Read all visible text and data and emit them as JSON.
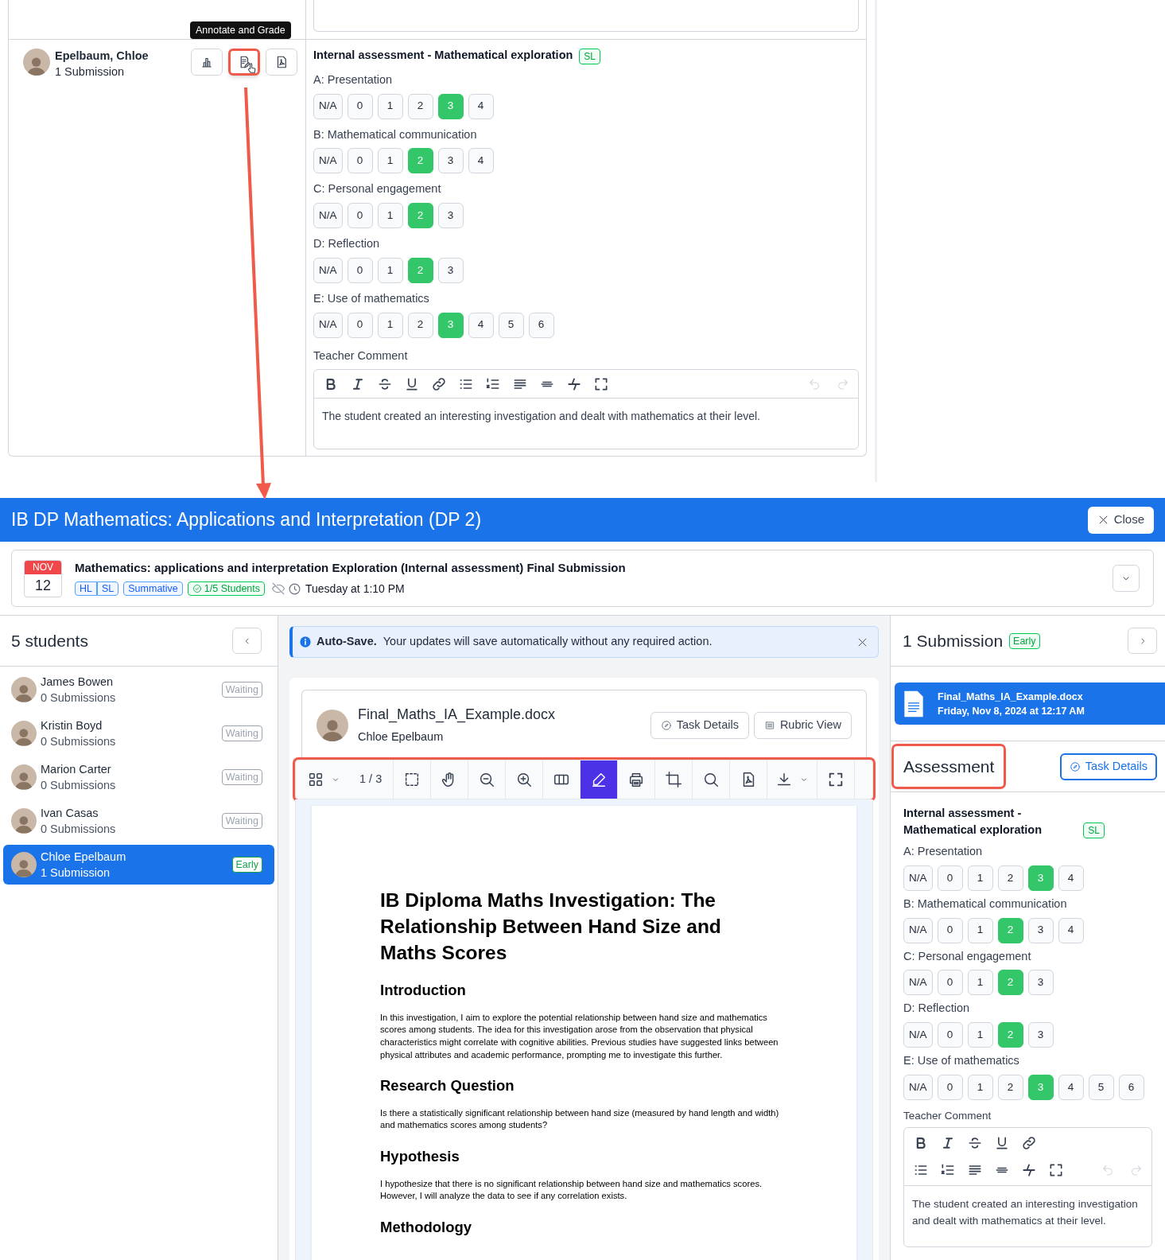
{
  "top_panel": {
    "tooltip": "Annotate and Grade",
    "student": {
      "name": "Epelbaum, Chloe",
      "submissions": "1 Submission"
    },
    "actions": [
      {
        "kind": "chart",
        "highlighted": false
      },
      {
        "kind": "annotate",
        "highlighted": true
      },
      {
        "kind": "pdf",
        "highlighted": false
      }
    ],
    "rubric": {
      "title": "Internal assessment - Mathematical exploration",
      "badge": "SL",
      "criteria": [
        {
          "label": "A: Presentation",
          "options": [
            {
              "label": "N/A",
              "selected": false
            },
            {
              "label": "0",
              "selected": false
            },
            {
              "label": "1",
              "selected": false
            },
            {
              "label": "2",
              "selected": false
            },
            {
              "label": "3",
              "selected": true
            },
            {
              "label": "4",
              "selected": false
            }
          ]
        },
        {
          "label": "B: Mathematical communication",
          "options": [
            {
              "label": "N/A",
              "selected": false
            },
            {
              "label": "0",
              "selected": false
            },
            {
              "label": "1",
              "selected": false
            },
            {
              "label": "2",
              "selected": true
            },
            {
              "label": "3",
              "selected": false
            },
            {
              "label": "4",
              "selected": false
            }
          ]
        },
        {
          "label": "C: Personal engagement",
          "options": [
            {
              "label": "N/A",
              "selected": false
            },
            {
              "label": "0",
              "selected": false
            },
            {
              "label": "1",
              "selected": false
            },
            {
              "label": "2",
              "selected": true
            },
            {
              "label": "3",
              "selected": false
            }
          ]
        },
        {
          "label": "D: Reflection",
          "options": [
            {
              "label": "N/A",
              "selected": false
            },
            {
              "label": "0",
              "selected": false
            },
            {
              "label": "1",
              "selected": false
            },
            {
              "label": "2",
              "selected": true
            },
            {
              "label": "3",
              "selected": false
            }
          ]
        },
        {
          "label": "E: Use of mathematics",
          "options": [
            {
              "label": "N/A",
              "selected": false
            },
            {
              "label": "0",
              "selected": false
            },
            {
              "label": "1",
              "selected": false
            },
            {
              "label": "2",
              "selected": false
            },
            {
              "label": "3",
              "selected": true
            },
            {
              "label": "4",
              "selected": false
            },
            {
              "label": "5",
              "selected": false
            },
            {
              "label": "6",
              "selected": false
            }
          ]
        }
      ]
    },
    "comment_label": "Teacher Comment",
    "comment": "The student created an interesting investigation and dealt with mathematics at their level."
  },
  "header": {
    "title": "IB DP Mathematics: Applications and Interpretation (DP 2)",
    "close": "Close"
  },
  "task": {
    "month": "NOV",
    "day": "12",
    "title": "Mathematics: applications and interpretation Exploration (Internal assessment) Final Submission",
    "tags": [
      {
        "label": "HL",
        "kind": "level"
      },
      {
        "label": "SL",
        "kind": "level"
      },
      {
        "label": "Summative",
        "kind": "type"
      },
      {
        "label": "1/5 Students",
        "kind": "count"
      }
    ],
    "due": "Tuesday at 1:10 PM"
  },
  "students": {
    "title": "5 students",
    "items": [
      {
        "name": "James Bowen",
        "submissions": "0 Submissions",
        "status": "Waiting",
        "color": "#9ca3af",
        "selected": false
      },
      {
        "name": "Kristin Boyd",
        "submissions": "0 Submissions",
        "status": "Waiting",
        "color": "#9ca3af",
        "selected": false
      },
      {
        "name": "Marion Carter",
        "submissions": "0 Submissions",
        "status": "Waiting",
        "color": "#9ca3af",
        "selected": false
      },
      {
        "name": "Ivan Casas",
        "submissions": "0 Submissions",
        "status": "Waiting",
        "color": "#9ca3af",
        "selected": false
      },
      {
        "name": "Chloe Epelbaum",
        "submissions": "1 Submission",
        "status": "Early",
        "color": "#16a34a",
        "selected": true
      }
    ]
  },
  "alert": {
    "title": "Auto-Save.",
    "message": "Your updates will save automatically without any required action."
  },
  "document": {
    "file": "Final_Maths_IA_Example.docx",
    "student": "Chloe Epelbaum",
    "buttons": [
      "Task Details",
      "Rubric View"
    ],
    "toolbar": {
      "highlighted": true,
      "tools": [
        {
          "kind": "grid",
          "selected": false
        },
        {
          "kind": "page",
          "label": "1 / 3",
          "selected": false
        },
        {
          "kind": "select",
          "selected": false
        },
        {
          "kind": "hand",
          "selected": false
        },
        {
          "kind": "zoom-out",
          "selected": false
        },
        {
          "kind": "zoom-in",
          "selected": false
        },
        {
          "kind": "columns",
          "selected": false
        },
        {
          "kind": "pen",
          "selected": true
        },
        {
          "kind": "print",
          "selected": false
        },
        {
          "kind": "crop",
          "selected": false
        },
        {
          "kind": "search",
          "selected": false
        },
        {
          "kind": "pdf",
          "selected": false
        },
        {
          "kind": "download",
          "selected": false
        },
        {
          "kind": "fullscreen",
          "selected": false
        }
      ]
    },
    "page": {
      "title": "IB Diploma Maths Investigation: The Relationship Between Hand Size and Maths Scores",
      "sections": [
        {
          "heading": "Introduction",
          "text": "In this investigation, I aim to explore the potential relationship between hand size and mathematics scores among students. The idea for this investigation arose from the observation that physical characteristics might correlate with cognitive abilities. Previous studies have suggested links between physical attributes and academic performance, prompting me to investigate this further."
        },
        {
          "heading": "Research Question",
          "text": "Is there a statistically significant relationship between hand size (measured by hand length and width) and mathematics scores among students?"
        },
        {
          "heading": "Hypothesis",
          "text": "I hypothesize that there is no significant relationship between hand size and mathematics scores. However, I will analyze the data to see if any correlation exists."
        },
        {
          "heading": "Methodology"
        }
      ]
    }
  },
  "submission": {
    "title": "1 Submission",
    "badge": "Early",
    "file": {
      "name": "Final_Maths_IA_Example.docx",
      "date": "Friday, Nov 8, 2024 at 12:17 AM"
    }
  },
  "assessment": {
    "title": "Assessment",
    "highlighted": true,
    "button": "Task Details",
    "rubric": {
      "title": "Internal assessment - Mathematical exploration",
      "badge": "SL",
      "criteria": [
        {
          "label": "A: Presentation",
          "options": [
            {
              "label": "N/A",
              "selected": false
            },
            {
              "label": "0",
              "selected": false
            },
            {
              "label": "1",
              "selected": false
            },
            {
              "label": "2",
              "selected": false
            },
            {
              "label": "3",
              "selected": true
            },
            {
              "label": "4",
              "selected": false
            }
          ]
        },
        {
          "label": "B: Mathematical communication",
          "options": [
            {
              "label": "N/A",
              "selected": false
            },
            {
              "label": "0",
              "selected": false
            },
            {
              "label": "1",
              "selected": false
            },
            {
              "label": "2",
              "selected": true
            },
            {
              "label": "3",
              "selected": false
            },
            {
              "label": "4",
              "selected": false
            }
          ]
        },
        {
          "label": "C: Personal engagement",
          "options": [
            {
              "label": "N/A",
              "selected": false
            },
            {
              "label": "0",
              "selected": false
            },
            {
              "label": "1",
              "selected": false
            },
            {
              "label": "2",
              "selected": true
            },
            {
              "label": "3",
              "selected": false
            }
          ]
        },
        {
          "label": "D: Reflection",
          "options": [
            {
              "label": "N/A",
              "selected": false
            },
            {
              "label": "0",
              "selected": false
            },
            {
              "label": "1",
              "selected": false
            },
            {
              "label": "2",
              "selected": true
            },
            {
              "label": "3",
              "selected": false
            }
          ]
        },
        {
          "label": "E: Use of mathematics",
          "options": [
            {
              "label": "N/A",
              "selected": false
            },
            {
              "label": "0",
              "selected": false
            },
            {
              "label": "1",
              "selected": false
            },
            {
              "label": "2",
              "selected": false
            },
            {
              "label": "3",
              "selected": true
            },
            {
              "label": "4",
              "selected": false
            },
            {
              "label": "5",
              "selected": false
            },
            {
              "label": "6",
              "selected": false
            }
          ]
        }
      ]
    },
    "comment_label": "Teacher Comment",
    "comment": "The student created an interesting investigation and dealt with mathematics at their level."
  }
}
